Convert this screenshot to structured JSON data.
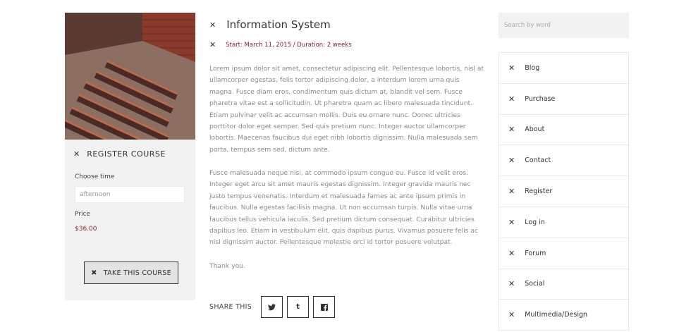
{
  "course": {
    "register_title": "REGISTER COURSE",
    "choose_time_label": "Choose time",
    "time_placeholder": "afternoon",
    "price_label": "Price",
    "price_value": "$36.00",
    "take_button": "TAKE THIS COURSE"
  },
  "article": {
    "title": "Information System",
    "meta": "Start: March 11, 2015 / Duration: 2 weeks",
    "paragraphs": [
      "Lorem ipsum dolor sit amet, consectetur adipiscing elit. Pellentesque lobortis, nisl at ullamcorper egestas, felis tortor adipiscing dolor, a interdum lorem urna quis magna. Fusce diam eros, condimentum quis dictum at, blandit vel sem. Fusce pharetra vitae est a sollicitudin. Ut pharetra quam ac libero malesuada tincidunt. Etiam pulvinar velit ac accumsan mollis. Duis eu ornare nunc. Donec ultricies porttitor dolor eget semper. Sed quis pretium nunc. Integer auctor ullamcorper lobortis. Maecenas faucibus dui eget nibh lobortis dignissim. Nulla malesuada sem porta, tempus sem sed, dictum ante.",
      "Fusce malesuada neque nisi, at commodo ipsum congue eu. Fusce id velit eros. Integer eget arcu sit amet mauris egestas dignissim. Integer gravida mauris nec justo tempus venenatis. Interdum et malesuada fames ac ante ipsum primis in faucibus. Nulla egestas facilisis magna. Ut non accumsan turpis. Nulla vitae urna faucibus tellus vehicula iaculis. Sed pretium dictum consequat. Curabitur ultricies dapibus leo. Etiam in vestibulum elit, quis dapibus purus. Vivamus posuere felis ac nisl dignissim auctor. Pellentesque molestie orci id tortor posuere volutpat.",
      "Thank you."
    ],
    "share_label": "SHARE THIS",
    "share_icons": [
      "twitter-icon",
      "tumblr-icon",
      "facebook-icon"
    ]
  },
  "sidebar": {
    "search_placeholder": "Search by word",
    "items": [
      {
        "label": "Blog"
      },
      {
        "label": "Purchase"
      },
      {
        "label": "About"
      },
      {
        "label": "Contact"
      },
      {
        "label": "Register"
      },
      {
        "label": "Log in"
      },
      {
        "label": "Forum"
      },
      {
        "label": "Social"
      },
      {
        "label": "Multimedia/Design"
      }
    ]
  },
  "colors": {
    "accent": "#8b1f2e",
    "panel": "#f2f2f2"
  }
}
